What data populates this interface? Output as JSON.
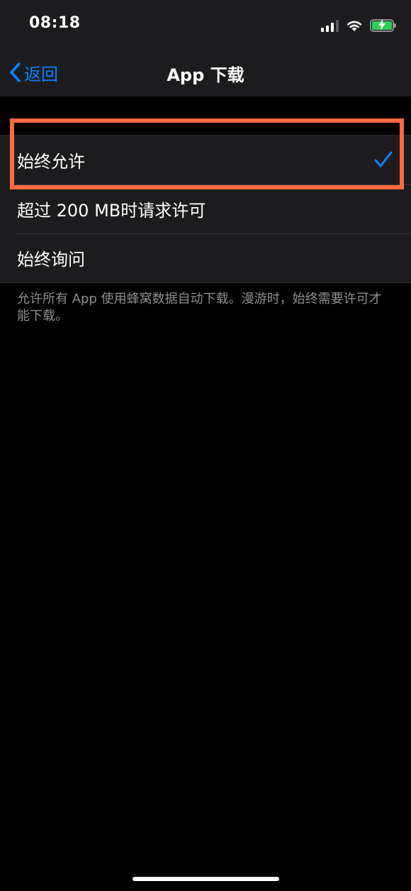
{
  "status_bar": {
    "time": "08:18",
    "icons": [
      "signal-icon",
      "wifi-icon",
      "battery-charging-icon"
    ],
    "battery_color": "#30d158"
  },
  "nav": {
    "back_label": "返回",
    "title": "App 下载",
    "accent_color": "#0a84ff"
  },
  "options": {
    "items": [
      {
        "label": "始终允许",
        "selected": true
      },
      {
        "label": "超过 200 MB时请求许可",
        "selected": false
      },
      {
        "label": "始终询问",
        "selected": false
      }
    ],
    "highlight_color": "#ff6b3d"
  },
  "footnote": "允许所有 App 使用蜂窝数据自动下载。漫游时，始终需要许可才能下载。"
}
